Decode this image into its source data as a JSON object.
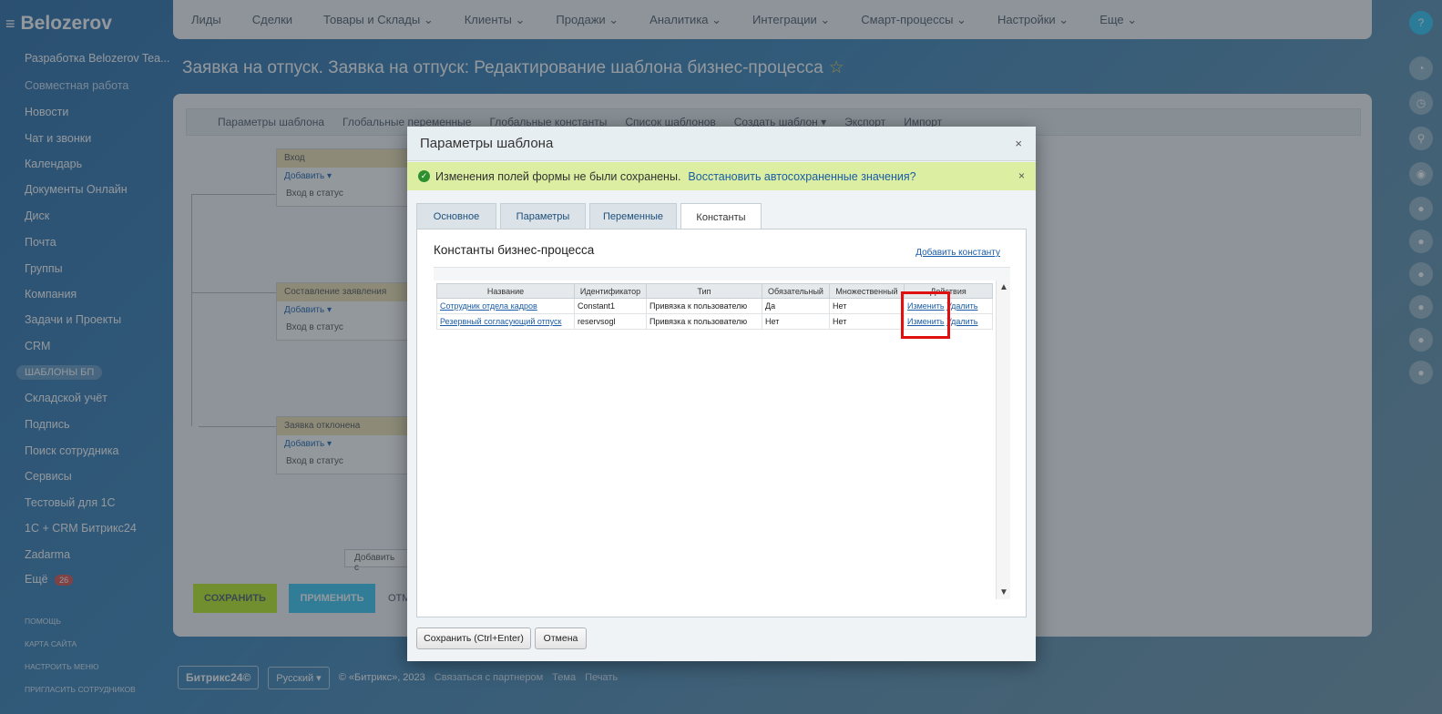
{
  "app": {
    "brand": "Belozerov",
    "page_title": "Заявка на отпуск. Заявка на отпуск: Редактирование шаблона бизнес-процесса"
  },
  "sidebar": {
    "items": [
      "Разработка Belozerov Tea...",
      "Совместная работа",
      "Новости",
      "Чат и звонки",
      "Календарь",
      "Документы Онлайн",
      "Диск",
      "Почта",
      "Группы",
      "Компания",
      "Задачи и Проекты",
      "CRM",
      "ШАБЛОНЫ БП",
      "Складской учёт",
      "Подпись",
      "Поиск сотрудника",
      "Сервисы",
      "Тестовый для 1С",
      "1С + CRM Битрикс24",
      "Zadarma",
      "Ещё"
    ],
    "more_badge": "26",
    "small_links": [
      "Помощь",
      "Карта сайта",
      "Настроить меню",
      "Пригласить сотрудников"
    ]
  },
  "topbar": {
    "items": [
      "Лиды",
      "Сделки",
      "Товары и Склады ⌄",
      "Клиенты ⌄",
      "Продажи ⌄",
      "Аналитика ⌄",
      "Интеграции ⌄",
      "Смарт-процессы ⌄",
      "Настройки ⌄",
      "Еще ⌄"
    ]
  },
  "workarea": {
    "toolbar": [
      "Параметры шаблона",
      "Глобальные переменные",
      "Глобальные константы",
      "Список шаблонов",
      "Создать шаблон ▾",
      "Экспорт",
      "Импорт"
    ],
    "blocks": [
      {
        "title": "Вход",
        "add": "Добавить ▾",
        "item": "Вход в статус"
      },
      {
        "title": "Составление заявления",
        "add": "Добавить ▾",
        "item": "Вход в статус"
      },
      {
        "title": "Заявка отклонена",
        "add": "Добавить ▾",
        "item": "Вход в статус"
      }
    ],
    "add_state": "Добавить с",
    "save": "СОХРАНИТЬ",
    "apply": "ПРИМЕНИТЬ",
    "cancel": "ОТМ"
  },
  "footer": {
    "logo": "Битрикс24©",
    "lang": "Русский ▾",
    "copyright": "© «Битрикс», 2023",
    "partner": "Связаться с партнером",
    "theme": "Тема",
    "print": "Печать"
  },
  "dialog": {
    "title": "Параметры шаблона",
    "close": "×",
    "notice": {
      "text": "Изменения полей формы не были сохранены.",
      "link": "Восстановить автосохраненные значения?",
      "close": "×"
    },
    "tabs": [
      {
        "label": "Основное",
        "active": false
      },
      {
        "label": "Параметры",
        "active": false
      },
      {
        "label": "Переменные",
        "active": false
      },
      {
        "label": "Константы",
        "active": true
      }
    ],
    "section_title": "Константы бизнес-процесса",
    "add_constant": "Добавить константу",
    "table": {
      "headers": [
        "Название",
        "Идентификатор",
        "Тип",
        "Обязательный",
        "Множественный",
        "Действия"
      ],
      "rows": [
        {
          "name": "Сотрудник отдела кадров",
          "id": "Constant1",
          "type": "Привязка к пользователю",
          "required": "Да",
          "multiple": "Нет",
          "edit": "Изменить",
          "delete": "Удалить"
        },
        {
          "name": "Резервный согласующий отпуск",
          "id": "reservsogl",
          "type": "Привязка к пользователю",
          "required": "Нет",
          "multiple": "Нет",
          "edit": "Изменить",
          "delete": "Удалить"
        }
      ]
    },
    "buttons": {
      "save": "Сохранить (Ctrl+Enter)",
      "cancel": "Отмена"
    }
  },
  "colors": {
    "notice_bg": "#dbeea1",
    "link": "#1a5ca8",
    "highlight": "#e01010"
  }
}
